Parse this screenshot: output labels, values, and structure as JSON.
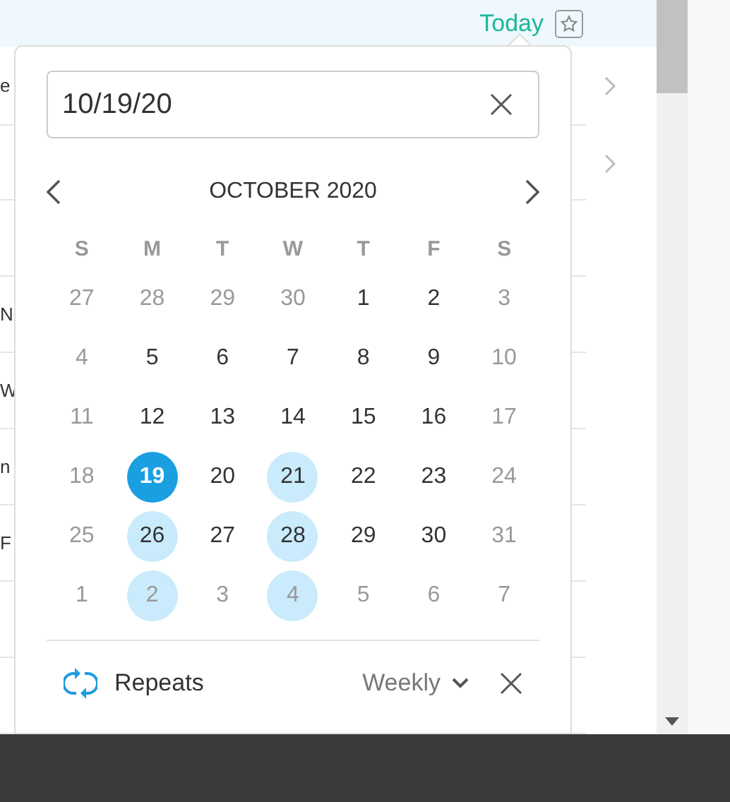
{
  "header": {
    "today_link": "Today"
  },
  "list_rows": [
    {
      "text": "e",
      "has_chevron": true
    },
    {
      "has_chevron": true
    },
    {
      "has_chevron": false
    },
    {
      "text": "N",
      "has_chevron": false
    },
    {
      "text": "W",
      "has_chevron": false
    },
    {
      "text": "n",
      "has_chevron": false
    },
    {
      "text": "F",
      "has_chevron": false
    },
    {
      "has_chevron": false
    },
    {
      "has_chevron": false
    }
  ],
  "date_picker": {
    "date_field": {
      "value": "10/19/20"
    },
    "month_title": "OCTOBER 2020",
    "weekdays": [
      "S",
      "M",
      "T",
      "W",
      "T",
      "F",
      "S"
    ],
    "days": [
      {
        "label": "27",
        "muted": true,
        "selected": false,
        "repeat": false
      },
      {
        "label": "28",
        "muted": true,
        "selected": false,
        "repeat": false
      },
      {
        "label": "29",
        "muted": true,
        "selected": false,
        "repeat": false
      },
      {
        "label": "30",
        "muted": true,
        "selected": false,
        "repeat": false
      },
      {
        "label": "1",
        "muted": false,
        "selected": false,
        "repeat": false
      },
      {
        "label": "2",
        "muted": false,
        "selected": false,
        "repeat": false
      },
      {
        "label": "3",
        "muted": true,
        "selected": false,
        "repeat": false
      },
      {
        "label": "4",
        "muted": true,
        "selected": false,
        "repeat": false
      },
      {
        "label": "5",
        "muted": false,
        "selected": false,
        "repeat": false
      },
      {
        "label": "6",
        "muted": false,
        "selected": false,
        "repeat": false
      },
      {
        "label": "7",
        "muted": false,
        "selected": false,
        "repeat": false
      },
      {
        "label": "8",
        "muted": false,
        "selected": false,
        "repeat": false
      },
      {
        "label": "9",
        "muted": false,
        "selected": false,
        "repeat": false
      },
      {
        "label": "10",
        "muted": true,
        "selected": false,
        "repeat": false
      },
      {
        "label": "11",
        "muted": true,
        "selected": false,
        "repeat": false
      },
      {
        "label": "12",
        "muted": false,
        "selected": false,
        "repeat": false
      },
      {
        "label": "13",
        "muted": false,
        "selected": false,
        "repeat": false
      },
      {
        "label": "14",
        "muted": false,
        "selected": false,
        "repeat": false
      },
      {
        "label": "15",
        "muted": false,
        "selected": false,
        "repeat": false
      },
      {
        "label": "16",
        "muted": false,
        "selected": false,
        "repeat": false
      },
      {
        "label": "17",
        "muted": true,
        "selected": false,
        "repeat": false
      },
      {
        "label": "18",
        "muted": true,
        "selected": false,
        "repeat": false
      },
      {
        "label": "19",
        "muted": false,
        "selected": true,
        "repeat": false
      },
      {
        "label": "20",
        "muted": false,
        "selected": false,
        "repeat": false
      },
      {
        "label": "21",
        "muted": false,
        "selected": false,
        "repeat": true
      },
      {
        "label": "22",
        "muted": false,
        "selected": false,
        "repeat": false
      },
      {
        "label": "23",
        "muted": false,
        "selected": false,
        "repeat": false
      },
      {
        "label": "24",
        "muted": true,
        "selected": false,
        "repeat": false
      },
      {
        "label": "25",
        "muted": true,
        "selected": false,
        "repeat": false
      },
      {
        "label": "26",
        "muted": false,
        "selected": false,
        "repeat": true
      },
      {
        "label": "27",
        "muted": false,
        "selected": false,
        "repeat": false
      },
      {
        "label": "28",
        "muted": false,
        "selected": false,
        "repeat": true
      },
      {
        "label": "29",
        "muted": false,
        "selected": false,
        "repeat": false
      },
      {
        "label": "30",
        "muted": false,
        "selected": false,
        "repeat": false
      },
      {
        "label": "31",
        "muted": true,
        "selected": false,
        "repeat": false
      },
      {
        "label": "1",
        "muted": true,
        "selected": false,
        "repeat": false
      },
      {
        "label": "2",
        "muted": true,
        "selected": false,
        "repeat": true
      },
      {
        "label": "3",
        "muted": true,
        "selected": false,
        "repeat": false
      },
      {
        "label": "4",
        "muted": true,
        "selected": false,
        "repeat": true
      },
      {
        "label": "5",
        "muted": true,
        "selected": false,
        "repeat": false
      },
      {
        "label": "6",
        "muted": true,
        "selected": false,
        "repeat": false
      },
      {
        "label": "7",
        "muted": true,
        "selected": false,
        "repeat": false
      }
    ],
    "repeat": {
      "label": "Repeats",
      "frequency": "Weekly"
    }
  }
}
